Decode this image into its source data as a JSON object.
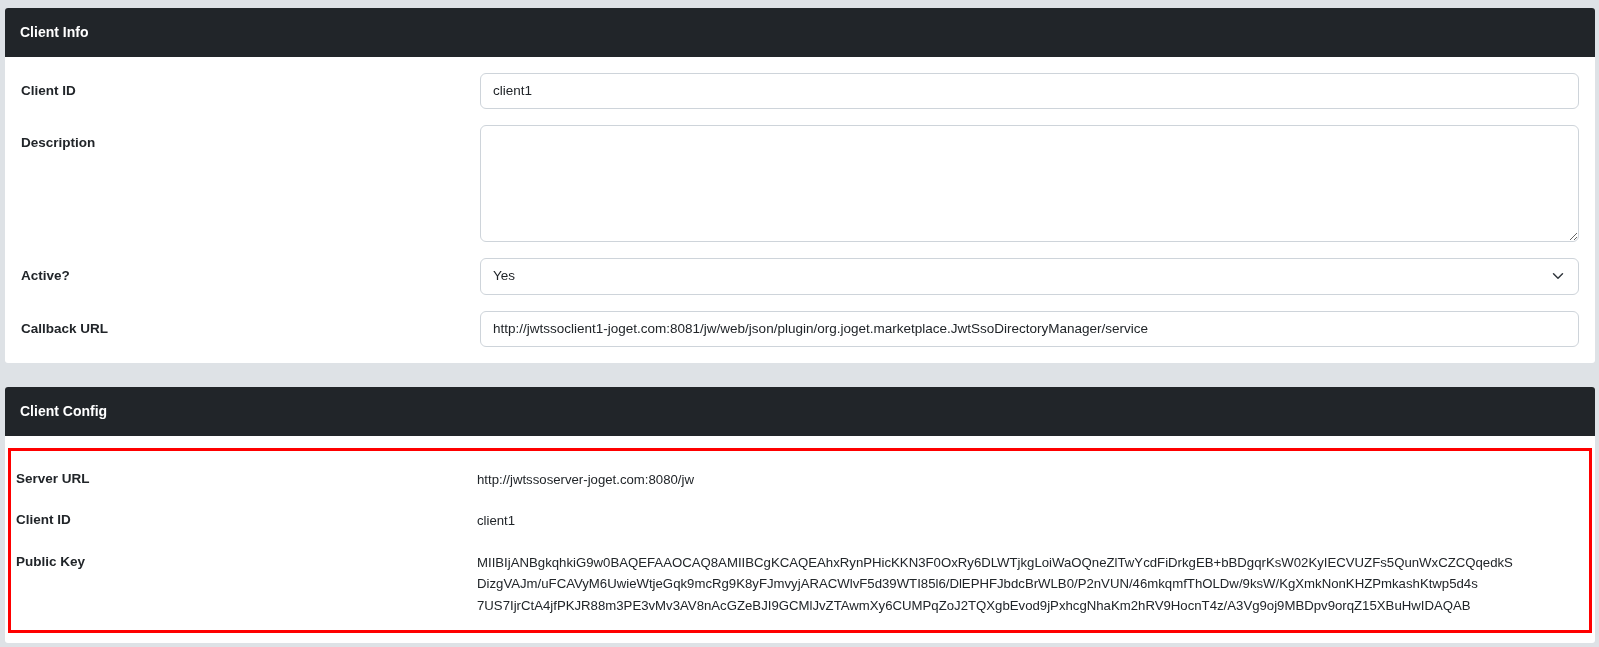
{
  "client_info": {
    "title": "Client Info",
    "fields": [
      {
        "kind": "input",
        "label": "Client ID",
        "value": "client1"
      },
      {
        "kind": "textarea",
        "label": "Description"
      },
      {
        "kind": "select",
        "label": "Active?",
        "value": "Yes"
      },
      {
        "kind": "input",
        "label": "Callback URL",
        "value": "http://jwtssoclient1-joget.com:8081/jw/web/json/plugin/org.joget.marketplace.JwtSsoDirectoryManager/service"
      }
    ]
  },
  "client_config": {
    "title": "Client Config",
    "highlighted": true,
    "rows": [
      {
        "label": "Server URL",
        "value_lines": [
          "http://jwtssoserver-joget.com:8080/jw"
        ]
      },
      {
        "label": "Client ID",
        "value_lines": [
          "client1"
        ]
      },
      {
        "label": "Public Key",
        "value_lines": [
          "MIIBIjANBgkqhkiG9w0BAQEFAAOCAQ8AMIIBCgKCAQEAhxRynPHicKKN3F0OxRy6DLWTjkgLoiWaOQneZlTwYcdFiDrkgEB+bBDgqrKsW02KyIECVUZFs5QunWxCZCQqedkS",
          "DizgVAJm/uFCAVyM6UwieWtjeGqk9mcRg9K8yFJmvyjARACWlvF5d39WTI85l6/DlEPHFJbdcBrWLB0/P2nVUN/46mkqmfThOLDw/9ksW/KgXmkNonKHZPmkashKtwp5d4s",
          "7US7IjrCtA4jfPKJR88m3PE3vMv3AV8nAcGZeBJI9GCMlJvZTAwmXy6CUMPqZoJ2TQXgbEvod9jPxhcgNhaKm2hRV9HocnT4z/A3Vg9oj9MBDpv9orqZ15XBuHwIDAQAB"
        ]
      }
    ]
  }
}
